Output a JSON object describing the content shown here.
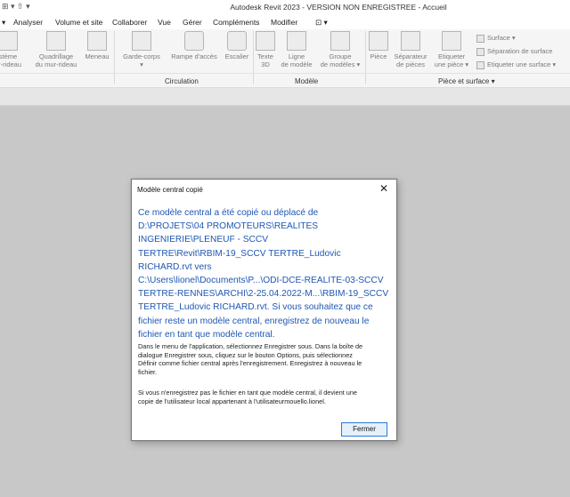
{
  "window": {
    "title": "Autodesk Revit 2023 - VERSION NON ENREGISTREE - Accueil",
    "qat_label": "⊞ ▾ ⇧ ▾"
  },
  "menubar": {
    "items": [
      "▾",
      "Analyser",
      "Volume et site",
      "Collaborer",
      "Vue",
      "Gérer",
      "Compléments",
      "Modifier",
      "⊡ ▾"
    ]
  },
  "ribbon": {
    "tools": [
      {
        "line1": "stème",
        "line2": "ur-rideau"
      },
      {
        "line1": "Quadrillage",
        "line2": "du mur-rideau"
      },
      {
        "line1": "Meneau",
        "line2": ""
      },
      {
        "line1": "Garde-corps",
        "line2": "▾"
      },
      {
        "line1": "Rampe d'accès",
        "line2": ""
      },
      {
        "line1": "Escalier",
        "line2": ""
      },
      {
        "line1": "Texte",
        "line2": "3D"
      },
      {
        "line1": "Ligne",
        "line2": "de modèle"
      },
      {
        "line1": "Groupe",
        "line2": "de modèles ▾"
      },
      {
        "line1": "Pièce",
        "line2": ""
      },
      {
        "line1": "Séparateur",
        "line2": "de pièces"
      },
      {
        "line1": "Etiqueter",
        "line2": "une pièce ▾"
      }
    ],
    "small_tools": [
      "Surface ▾",
      "Séparation de surface",
      "Etiqueter une surface ▾"
    ],
    "panels": [
      "Circulation",
      "Modèle",
      "Pièce et surface ▾"
    ]
  },
  "dialog": {
    "title": "Modèle central copié",
    "close_icon": "✕",
    "main_lines": [
      "Ce modèle central a été copié ou déplacé de",
      "D:\\PROJETS\\04 PROMOTEURS\\REALITES",
      "INGENIERIE\\PLENEUF - SCCV",
      "TERTRE\\Revit\\RBIM-19_SCCV TERTRE_Ludovic",
      "RICHARD.rvt vers",
      "C:\\Users\\lionel\\Documents\\P...\\ODI-DCE-REALITE-03-SCCV",
      "TERTRE-RENNES\\ARCHI\\2-25.04.2022-M...\\RBIM-19_SCCV",
      "TERTRE_Ludovic RICHARD.rvt. Si vous souhaitez que ce",
      "fichier reste un modèle central, enregistrez de nouveau le",
      "fichier en tant que modèle central."
    ],
    "para1_lines": [
      "Dans le menu de l'application, sélectionnez Enregistrer sous. Dans la boîte de",
      "dialogue Enregistrer sous, cliquez sur le bouton Options, puis sélectionnez",
      "Définir comme fichier central après l'enregistrement. Enregistrez à nouveau le",
      "fichier."
    ],
    "para2_lines": [
      "Si vous n'enregistrez pas le fichier en tant que modèle central, il devient une",
      "copie de l'utilisateur local appartenant à l'utilisateurmouello.lionel."
    ],
    "button_label": "Fermer"
  }
}
